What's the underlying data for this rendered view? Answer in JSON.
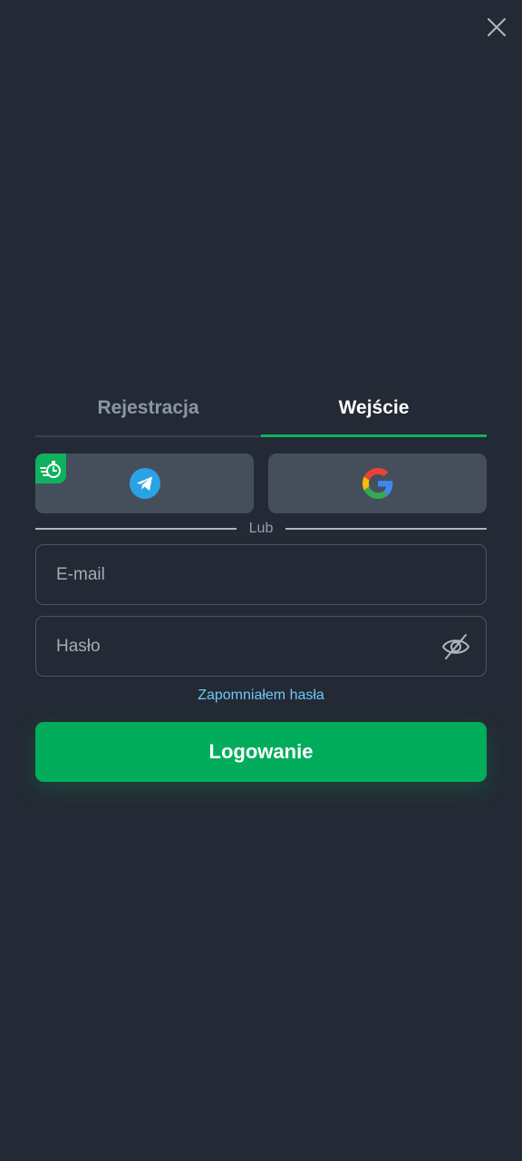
{
  "colors": {
    "background": "#232a35",
    "accent": "#01ad5b",
    "link": "#6ec7f5",
    "social_button": "#454f5b"
  },
  "tabs": [
    {
      "label": "Rejestracja",
      "active": false
    },
    {
      "label": "Wejście",
      "active": true
    }
  ],
  "social": {
    "telegram_icon": "telegram-icon",
    "google_icon": "google-icon",
    "badge_icon": "fast-login-stopwatch-icon"
  },
  "divider_text": "Lub",
  "form": {
    "email_placeholder": "E-mail",
    "email_value": "",
    "password_placeholder": "Hasło",
    "password_value": "",
    "password_toggle_icon": "eye-off-icon"
  },
  "forgot_password": "Zapomniałem hasła",
  "login_button": "Logowanie",
  "close_icon": "close-icon"
}
